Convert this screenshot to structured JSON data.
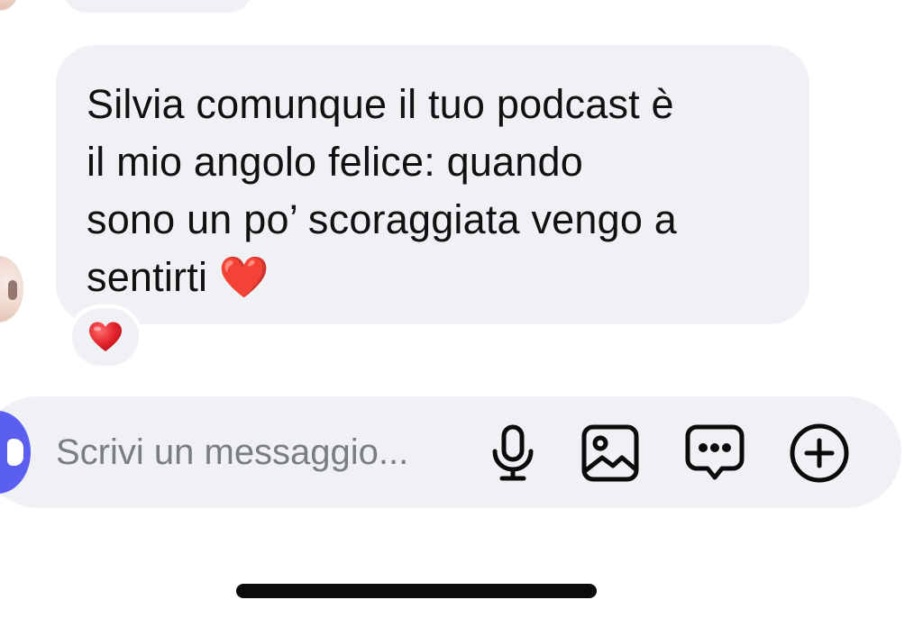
{
  "conversation": {
    "message": {
      "text": "Silvia comunque il tuo podcast è\nil mio angolo felice: quando\nsono un po’ scoraggiata vengo a\nsentirti ❤️",
      "reaction": "❤️"
    }
  },
  "composer": {
    "placeholder": "Scrivi un messaggio...",
    "icons": [
      "camera-icon",
      "microphone-icon",
      "image-icon",
      "chat-bubble-icon",
      "plus-circle-icon"
    ]
  },
  "colors": {
    "bubble": "#f0f1f4",
    "accent": "#5b5ff0",
    "text": "#111111",
    "placeholder": "#7a7d84",
    "heart": "#e3242b"
  }
}
